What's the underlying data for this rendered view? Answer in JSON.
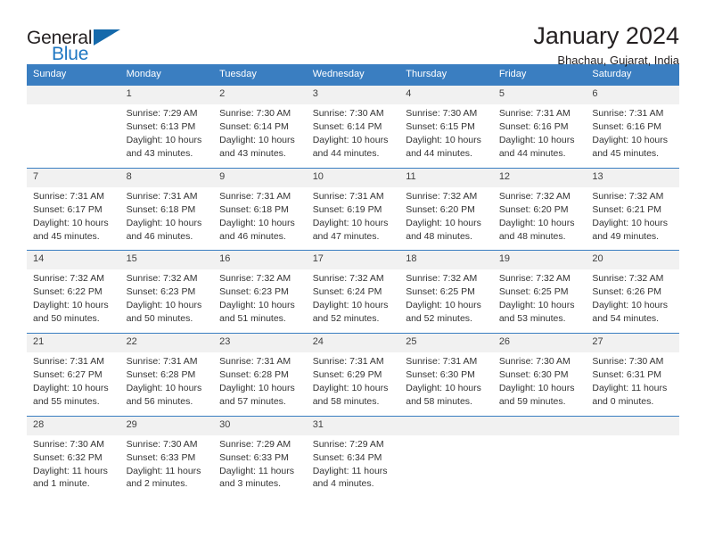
{
  "brand": {
    "name_part1": "General",
    "name_part2": "Blue"
  },
  "header": {
    "title": "January 2024",
    "location": "Bhachau, Gujarat, India"
  },
  "weekdays": [
    "Sunday",
    "Monday",
    "Tuesday",
    "Wednesday",
    "Thursday",
    "Friday",
    "Saturday"
  ],
  "colors": {
    "header_blue": "#3a7ec1",
    "logo_blue": "#1f77c2",
    "daynum_band": "#f1f1f1",
    "text": "#333333"
  },
  "weeks": [
    [
      {
        "day": "",
        "sunrise": "",
        "sunset": "",
        "daylight1": "",
        "daylight2": ""
      },
      {
        "day": "1",
        "sunrise": "Sunrise: 7:29 AM",
        "sunset": "Sunset: 6:13 PM",
        "daylight1": "Daylight: 10 hours",
        "daylight2": "and 43 minutes."
      },
      {
        "day": "2",
        "sunrise": "Sunrise: 7:30 AM",
        "sunset": "Sunset: 6:14 PM",
        "daylight1": "Daylight: 10 hours",
        "daylight2": "and 43 minutes."
      },
      {
        "day": "3",
        "sunrise": "Sunrise: 7:30 AM",
        "sunset": "Sunset: 6:14 PM",
        "daylight1": "Daylight: 10 hours",
        "daylight2": "and 44 minutes."
      },
      {
        "day": "4",
        "sunrise": "Sunrise: 7:30 AM",
        "sunset": "Sunset: 6:15 PM",
        "daylight1": "Daylight: 10 hours",
        "daylight2": "and 44 minutes."
      },
      {
        "day": "5",
        "sunrise": "Sunrise: 7:31 AM",
        "sunset": "Sunset: 6:16 PM",
        "daylight1": "Daylight: 10 hours",
        "daylight2": "and 44 minutes."
      },
      {
        "day": "6",
        "sunrise": "Sunrise: 7:31 AM",
        "sunset": "Sunset: 6:16 PM",
        "daylight1": "Daylight: 10 hours",
        "daylight2": "and 45 minutes."
      }
    ],
    [
      {
        "day": "7",
        "sunrise": "Sunrise: 7:31 AM",
        "sunset": "Sunset: 6:17 PM",
        "daylight1": "Daylight: 10 hours",
        "daylight2": "and 45 minutes."
      },
      {
        "day": "8",
        "sunrise": "Sunrise: 7:31 AM",
        "sunset": "Sunset: 6:18 PM",
        "daylight1": "Daylight: 10 hours",
        "daylight2": "and 46 minutes."
      },
      {
        "day": "9",
        "sunrise": "Sunrise: 7:31 AM",
        "sunset": "Sunset: 6:18 PM",
        "daylight1": "Daylight: 10 hours",
        "daylight2": "and 46 minutes."
      },
      {
        "day": "10",
        "sunrise": "Sunrise: 7:31 AM",
        "sunset": "Sunset: 6:19 PM",
        "daylight1": "Daylight: 10 hours",
        "daylight2": "and 47 minutes."
      },
      {
        "day": "11",
        "sunrise": "Sunrise: 7:32 AM",
        "sunset": "Sunset: 6:20 PM",
        "daylight1": "Daylight: 10 hours",
        "daylight2": "and 48 minutes."
      },
      {
        "day": "12",
        "sunrise": "Sunrise: 7:32 AM",
        "sunset": "Sunset: 6:20 PM",
        "daylight1": "Daylight: 10 hours",
        "daylight2": "and 48 minutes."
      },
      {
        "day": "13",
        "sunrise": "Sunrise: 7:32 AM",
        "sunset": "Sunset: 6:21 PM",
        "daylight1": "Daylight: 10 hours",
        "daylight2": "and 49 minutes."
      }
    ],
    [
      {
        "day": "14",
        "sunrise": "Sunrise: 7:32 AM",
        "sunset": "Sunset: 6:22 PM",
        "daylight1": "Daylight: 10 hours",
        "daylight2": "and 50 minutes."
      },
      {
        "day": "15",
        "sunrise": "Sunrise: 7:32 AM",
        "sunset": "Sunset: 6:23 PM",
        "daylight1": "Daylight: 10 hours",
        "daylight2": "and 50 minutes."
      },
      {
        "day": "16",
        "sunrise": "Sunrise: 7:32 AM",
        "sunset": "Sunset: 6:23 PM",
        "daylight1": "Daylight: 10 hours",
        "daylight2": "and 51 minutes."
      },
      {
        "day": "17",
        "sunrise": "Sunrise: 7:32 AM",
        "sunset": "Sunset: 6:24 PM",
        "daylight1": "Daylight: 10 hours",
        "daylight2": "and 52 minutes."
      },
      {
        "day": "18",
        "sunrise": "Sunrise: 7:32 AM",
        "sunset": "Sunset: 6:25 PM",
        "daylight1": "Daylight: 10 hours",
        "daylight2": "and 52 minutes."
      },
      {
        "day": "19",
        "sunrise": "Sunrise: 7:32 AM",
        "sunset": "Sunset: 6:25 PM",
        "daylight1": "Daylight: 10 hours",
        "daylight2": "and 53 minutes."
      },
      {
        "day": "20",
        "sunrise": "Sunrise: 7:32 AM",
        "sunset": "Sunset: 6:26 PM",
        "daylight1": "Daylight: 10 hours",
        "daylight2": "and 54 minutes."
      }
    ],
    [
      {
        "day": "21",
        "sunrise": "Sunrise: 7:31 AM",
        "sunset": "Sunset: 6:27 PM",
        "daylight1": "Daylight: 10 hours",
        "daylight2": "and 55 minutes."
      },
      {
        "day": "22",
        "sunrise": "Sunrise: 7:31 AM",
        "sunset": "Sunset: 6:28 PM",
        "daylight1": "Daylight: 10 hours",
        "daylight2": "and 56 minutes."
      },
      {
        "day": "23",
        "sunrise": "Sunrise: 7:31 AM",
        "sunset": "Sunset: 6:28 PM",
        "daylight1": "Daylight: 10 hours",
        "daylight2": "and 57 minutes."
      },
      {
        "day": "24",
        "sunrise": "Sunrise: 7:31 AM",
        "sunset": "Sunset: 6:29 PM",
        "daylight1": "Daylight: 10 hours",
        "daylight2": "and 58 minutes."
      },
      {
        "day": "25",
        "sunrise": "Sunrise: 7:31 AM",
        "sunset": "Sunset: 6:30 PM",
        "daylight1": "Daylight: 10 hours",
        "daylight2": "and 58 minutes."
      },
      {
        "day": "26",
        "sunrise": "Sunrise: 7:30 AM",
        "sunset": "Sunset: 6:30 PM",
        "daylight1": "Daylight: 10 hours",
        "daylight2": "and 59 minutes."
      },
      {
        "day": "27",
        "sunrise": "Sunrise: 7:30 AM",
        "sunset": "Sunset: 6:31 PM",
        "daylight1": "Daylight: 11 hours",
        "daylight2": "and 0 minutes."
      }
    ],
    [
      {
        "day": "28",
        "sunrise": "Sunrise: 7:30 AM",
        "sunset": "Sunset: 6:32 PM",
        "daylight1": "Daylight: 11 hours",
        "daylight2": "and 1 minute."
      },
      {
        "day": "29",
        "sunrise": "Sunrise: 7:30 AM",
        "sunset": "Sunset: 6:33 PM",
        "daylight1": "Daylight: 11 hours",
        "daylight2": "and 2 minutes."
      },
      {
        "day": "30",
        "sunrise": "Sunrise: 7:29 AM",
        "sunset": "Sunset: 6:33 PM",
        "daylight1": "Daylight: 11 hours",
        "daylight2": "and 3 minutes."
      },
      {
        "day": "31",
        "sunrise": "Sunrise: 7:29 AM",
        "sunset": "Sunset: 6:34 PM",
        "daylight1": "Daylight: 11 hours",
        "daylight2": "and 4 minutes."
      },
      {
        "day": "",
        "sunrise": "",
        "sunset": "",
        "daylight1": "",
        "daylight2": ""
      },
      {
        "day": "",
        "sunrise": "",
        "sunset": "",
        "daylight1": "",
        "daylight2": ""
      },
      {
        "day": "",
        "sunrise": "",
        "sunset": "",
        "daylight1": "",
        "daylight2": ""
      }
    ]
  ]
}
